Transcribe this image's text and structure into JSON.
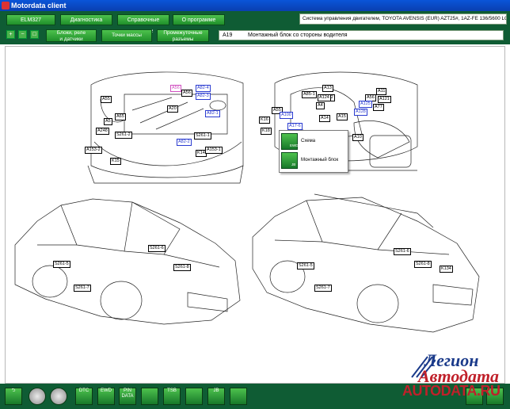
{
  "window": {
    "title": "Motordata client"
  },
  "toolbar": {
    "buttons": [
      "ELM327",
      "Диагностика",
      "Справочные данные",
      "О программе"
    ],
    "info": "Система управления двигателем, TOYOTA AVENSIS (EUR) AZT25#, 1AZ-FE 136/5600 LG 01.2003-",
    "subtabs": [
      {
        "l1": "Блоки, реле",
        "l2": "и датчики"
      },
      {
        "l1": "Точки массы",
        "l2": ""
      },
      {
        "l1": "Промежуточные",
        "l2": "разъемы"
      }
    ],
    "block_code": "A19",
    "block_desc": "Монтажный блок со стороны водителя"
  },
  "popup": {
    "items": [
      "Схема",
      "Монтажный блок"
    ],
    "icon_labels": [
      "EWD",
      "JB"
    ]
  },
  "engine_labels": [
    "A55",
    "A56",
    "A56",
    "A82-4",
    "A82-3",
    "A65",
    "A82-1",
    "A20",
    "A248",
    "A5",
    "S261-2",
    "S261-1",
    "K14",
    "A153-2",
    "A153-1",
    "K15",
    "A82-2"
  ],
  "cabin_labels": [
    "A13",
    "A85-1",
    "A12",
    "A124",
    "A11",
    "A121",
    "A56",
    "A4",
    "A125",
    "A77",
    "A15",
    "A14",
    "A128",
    "A55",
    "K16",
    "A100",
    "K18",
    "A17-6",
    "A10"
  ],
  "sedan_labels": [
    "S261-6",
    "S261-8",
    "S261-5",
    "S261-7"
  ],
  "wagon_labels": [
    "S261-6",
    "S261-8",
    "S261-5",
    "K134",
    "S261-7"
  ],
  "bottom": {
    "buttons": [
      "",
      "",
      "",
      "DTC",
      "EWD",
      "PIN DATA",
      "",
      "TSB",
      "",
      "JB",
      "",
      "",
      ""
    ]
  },
  "logo": {
    "line1": "Легион",
    "line2": "Автодата",
    "url": "AUTODATA.RU"
  }
}
